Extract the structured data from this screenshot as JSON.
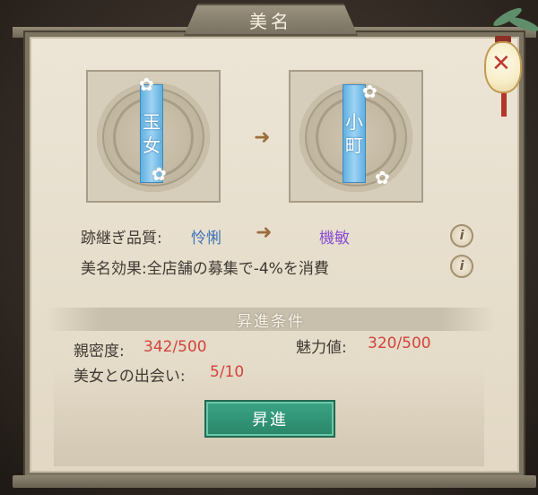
{
  "window": {
    "title": "美名"
  },
  "current_title": {
    "chars": [
      "玉",
      "女"
    ]
  },
  "next_title": {
    "chars": [
      "小",
      "町"
    ]
  },
  "quality_row": {
    "label": "跡継ぎ品質:",
    "current_value": "怜悧",
    "next_value": "機敏"
  },
  "effect_row": {
    "text": "美名効果:全店舗の募集で-4%を消費"
  },
  "conditions": {
    "title": "昇進条件",
    "intimacy": {
      "label": "親密度:",
      "value": "342/500"
    },
    "charm": {
      "label": "魅力値:",
      "value": "320/500"
    },
    "meetings": {
      "label": "美女との出会い:",
      "value": "5/10"
    }
  },
  "upgrade_button": {
    "label": "昇進"
  },
  "icons": {
    "arrow": "right-arrow-icon",
    "info": "info-icon",
    "flower": "white-flower-icon",
    "lantern": "lantern-close-icon"
  },
  "colors": {
    "accent_blue": "#3d73b8",
    "accent_purple": "#8a4ed0",
    "progress_red": "#d2453e",
    "button_green": "#2a8569",
    "ribbon_blue": "#5fb0e0"
  }
}
